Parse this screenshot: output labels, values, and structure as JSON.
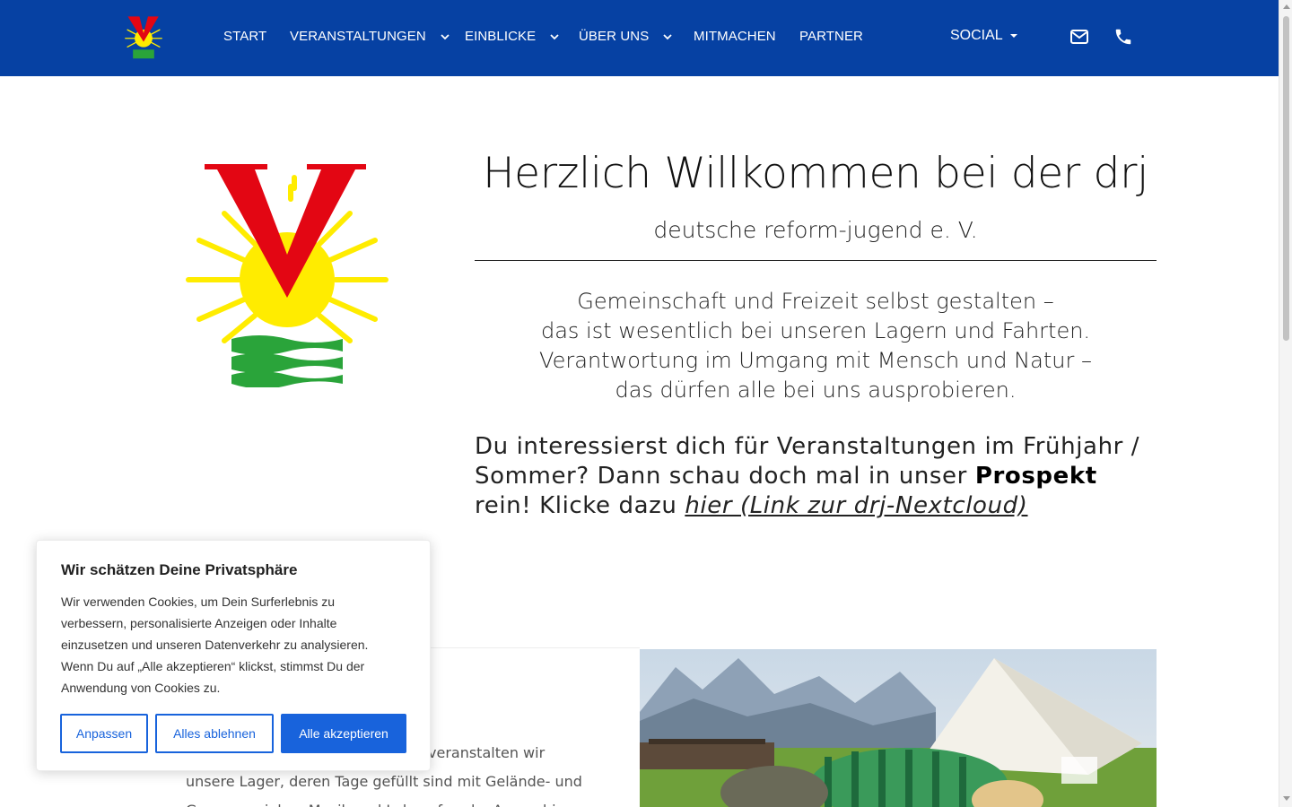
{
  "nav": {
    "items": [
      {
        "label": "START"
      },
      {
        "label": "VERANSTALTUNGEN"
      },
      {
        "label": "EINBLICKE"
      },
      {
        "label": "ÜBER UNS"
      },
      {
        "label": "MITMACHEN"
      },
      {
        "label": "PARTNER"
      }
    ],
    "social_label": "SOCIAL",
    "icons": [
      "mail-icon",
      "phone-icon"
    ],
    "background_color": "#0641a3"
  },
  "hero": {
    "title": "Herzlich Willkommen bei der drj",
    "subtitle": "deutsche reform-jugend e. V.",
    "lines": [
      "Gemeinschaft und Freizeit selbst gestalten –",
      "das ist wesentlich bei unseren Lagern und Fahrten.",
      "Verantwortung im Umgang mit Mensch und Natur –",
      "das dürfen alle bei uns ausprobieren."
    ],
    "prospect_part1": "Du interessierst dich für Veranstaltungen im Frühjahr / Sommer? Dann schau doch mal in unser ",
    "prospect_bold": "Prospekt",
    "prospect_part2": " rein! Klicke dazu ",
    "prospect_link": "hier (Link zur drj-Nextcloud)"
  },
  "lower": {
    "text_visible": "veranstalten wir unsere Lager, deren Tage gefüllt sind mit Gelände- und Gruppenspielen, Musik und Lebensfreude. Ausprobieren"
  },
  "cookie": {
    "title": "Wir schätzen Deine Privatsphäre",
    "text": "Wir verwenden Cookies, um Dein Surferlebnis zu verbessern, personalisierte Anzeigen oder Inhalte einzusetzen und unseren Datenverkehr zu analysieren. Wenn Du auf „Alle akzeptieren“ klickst, stimmst Du der Anwendung von Cookies zu.",
    "customize_label": "Anpassen",
    "reject_label": "Alles ablehnen",
    "accept_label": "Alle akzeptieren",
    "accent_color": "#1863dc"
  },
  "logo": {
    "colors": {
      "v": "#e30613",
      "sun": "#ffec00",
      "water": "#2aa43a"
    }
  }
}
